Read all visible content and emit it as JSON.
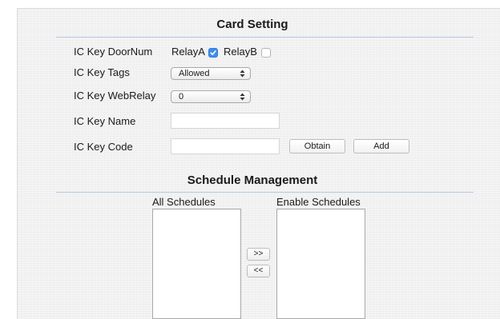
{
  "card_setting": {
    "title": "Card Setting",
    "doornum": {
      "label": "IC Key DoorNum",
      "relay_a_label": "RelayA",
      "relay_a_checked": true,
      "relay_b_label": "RelayB",
      "relay_b_checked": false
    },
    "tags": {
      "label": "IC Key Tags",
      "selected": "Allowed"
    },
    "webrelay": {
      "label": "IC Key WebRelay",
      "selected": "0"
    },
    "name": {
      "label": "IC Key Name",
      "value": ""
    },
    "code": {
      "label": "IC Key Code",
      "value": "",
      "obtain_label": "Obtain",
      "add_label": "Add"
    }
  },
  "schedule_management": {
    "title": "Schedule Management",
    "all_label": "All Schedules",
    "enable_label": "Enable Schedules",
    "move_right_label": ">>",
    "move_left_label": "<<",
    "all_items": [],
    "enabled_items": []
  },
  "colors": {
    "checkbox_accent": "#3d8ef0",
    "divider": "#b7c9e4",
    "panel_bg": "#f4f4f4"
  }
}
